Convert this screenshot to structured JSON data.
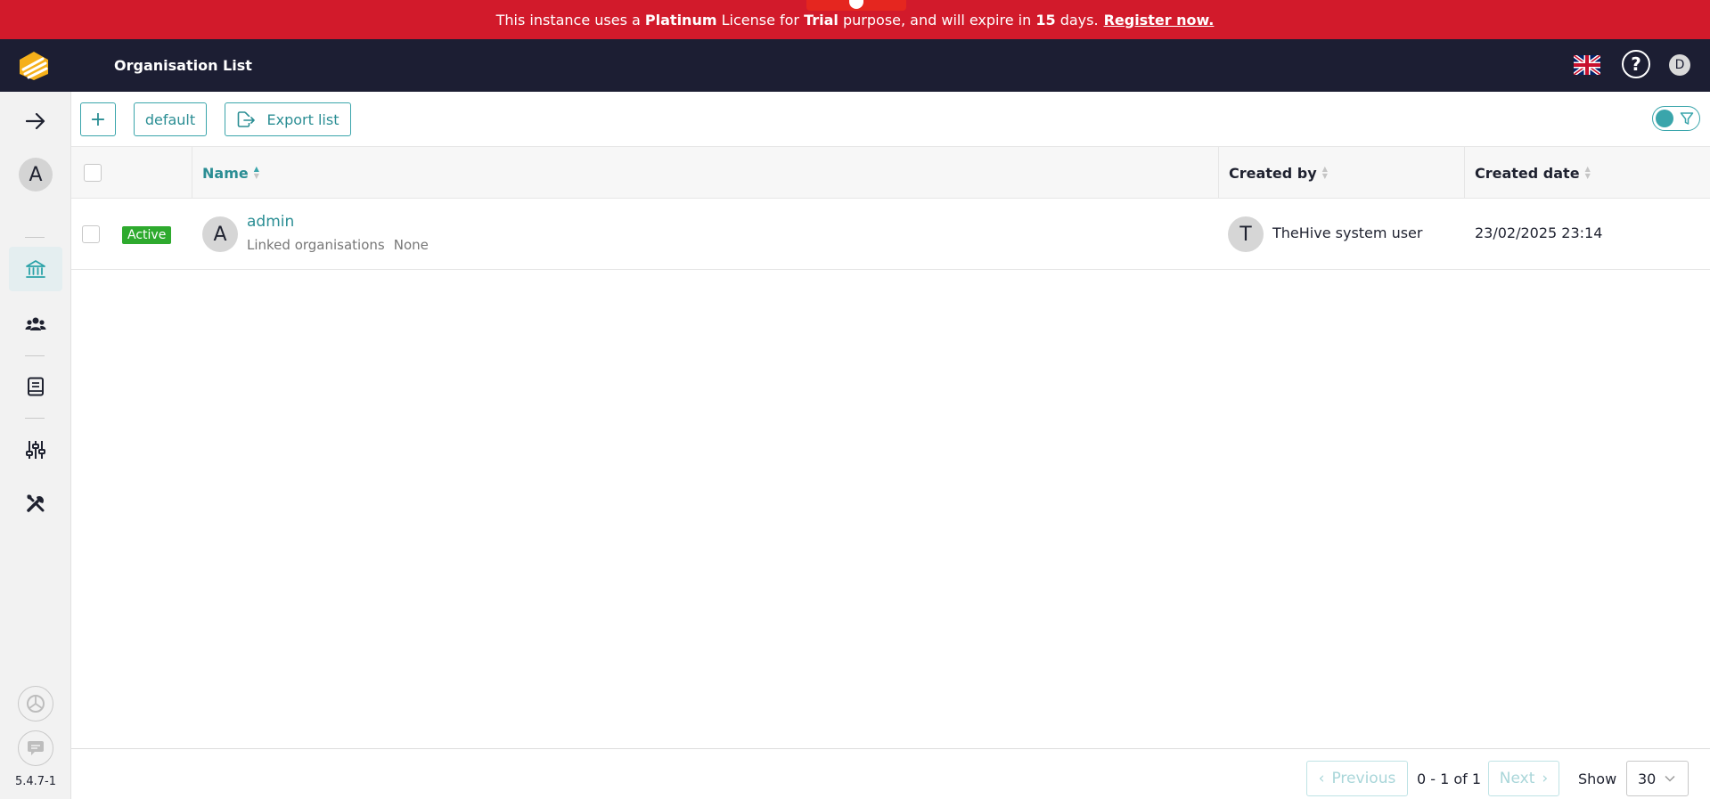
{
  "banner": {
    "text_1": "This instance uses a",
    "plan": "Platinum",
    "text_2": "License for",
    "purpose": "Trial",
    "text_3": "purpose, and will expire in",
    "days": "15",
    "text_4": "days.",
    "register_link": "Register now."
  },
  "header": {
    "title": "Organisation List",
    "language": "English",
    "help_symbol": "?",
    "user_initial": "D"
  },
  "sidebar": {
    "org_initial": "A",
    "version": "5.4.7-1",
    "active_item": "organisations",
    "items": [
      "expand",
      "organisations",
      "users",
      "knowledge-base",
      "settings",
      "platform-management"
    ]
  },
  "toolbar": {
    "add_symbol": "+",
    "default_label": "default",
    "export_label": "Export list"
  },
  "table": {
    "columns": {
      "name": "Name",
      "created_by": "Created by",
      "created_date": "Created date"
    },
    "rows": [
      {
        "status": "Active",
        "initial": "A",
        "name": "admin",
        "linked_label": "Linked organisations",
        "linked_value": "None",
        "creator_initial": "T",
        "created_by": "TheHive system user",
        "created_date": "23/02/2025 23:14"
      }
    ]
  },
  "pagination": {
    "previous_label": "Previous",
    "range": "0 - 1 of 1",
    "next_label": "Next",
    "show_label": "Show",
    "page_size": "30"
  },
  "colors": {
    "banner": "#d21a2b",
    "header": "#1c1e33",
    "accent": "#2aa2a8",
    "status_active": "#2eaa2e"
  }
}
